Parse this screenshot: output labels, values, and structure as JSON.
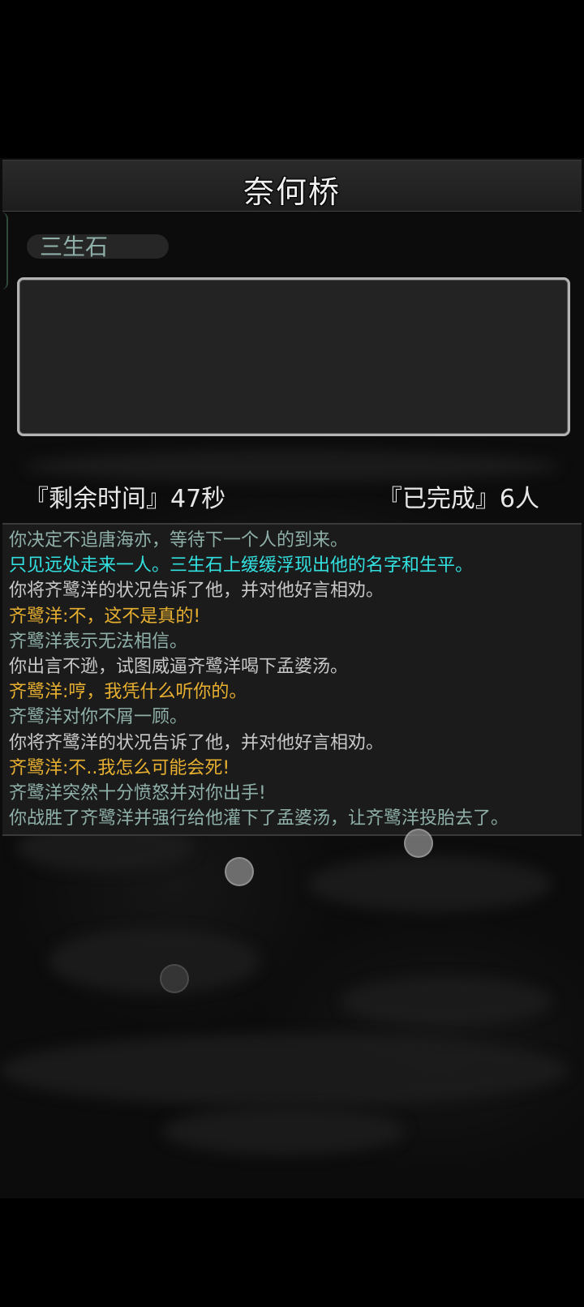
{
  "header": {
    "title": "奈何桥"
  },
  "stone": {
    "label": "三生石",
    "content": ""
  },
  "stats": {
    "time_remaining": "『剩余时间』47秒",
    "completed": "『已完成』6人"
  },
  "log": {
    "lines": [
      {
        "text": "你决定不追唐海亦，等待下一个人的到来。",
        "color": "#8fb0a8"
      },
      {
        "text": "只见远处走来一人。三生石上缓缓浮现出他的名字和生平。",
        "color": "#33e0e0"
      },
      {
        "text": "你将齐鹭洋的状况告诉了他，并对他好言相劝。",
        "color": "#c8c8c8"
      },
      {
        "text": "齐鹭洋:不，这不是真的!",
        "color": "#e8b030"
      },
      {
        "text": "齐鹭洋表示无法相信。",
        "color": "#8fb0a8"
      },
      {
        "text": "你出言不逊，试图威逼齐鹭洋喝下孟婆汤。",
        "color": "#c8c8c8"
      },
      {
        "text": "齐鹭洋:哼，我凭什么听你的。",
        "color": "#e8b030"
      },
      {
        "text": "齐鹭洋对你不屑一顾。",
        "color": "#8fb0a8"
      },
      {
        "text": "你将齐鹭洋的状况告诉了他，并对他好言相劝。",
        "color": "#c8c8c8"
      },
      {
        "text": "齐鹭洋:不..我怎么可能会死!",
        "color": "#e8b030"
      },
      {
        "text": "齐鹭洋突然十分愤怒并对你出手!",
        "color": "#8fb0a8"
      },
      {
        "text": "你战胜了齐鹭洋并强行给他灌下了孟婆汤，让齐鹭洋投胎去了。",
        "color": "#8fb0a8"
      }
    ]
  },
  "colors": {
    "background": "#000000",
    "panel": "#1b1b1b",
    "accent_cyan": "#33e0e0",
    "dialog_yellow": "#e8b030",
    "narration_teal": "#8fb0a8",
    "text_gray": "#c8c8c8"
  }
}
